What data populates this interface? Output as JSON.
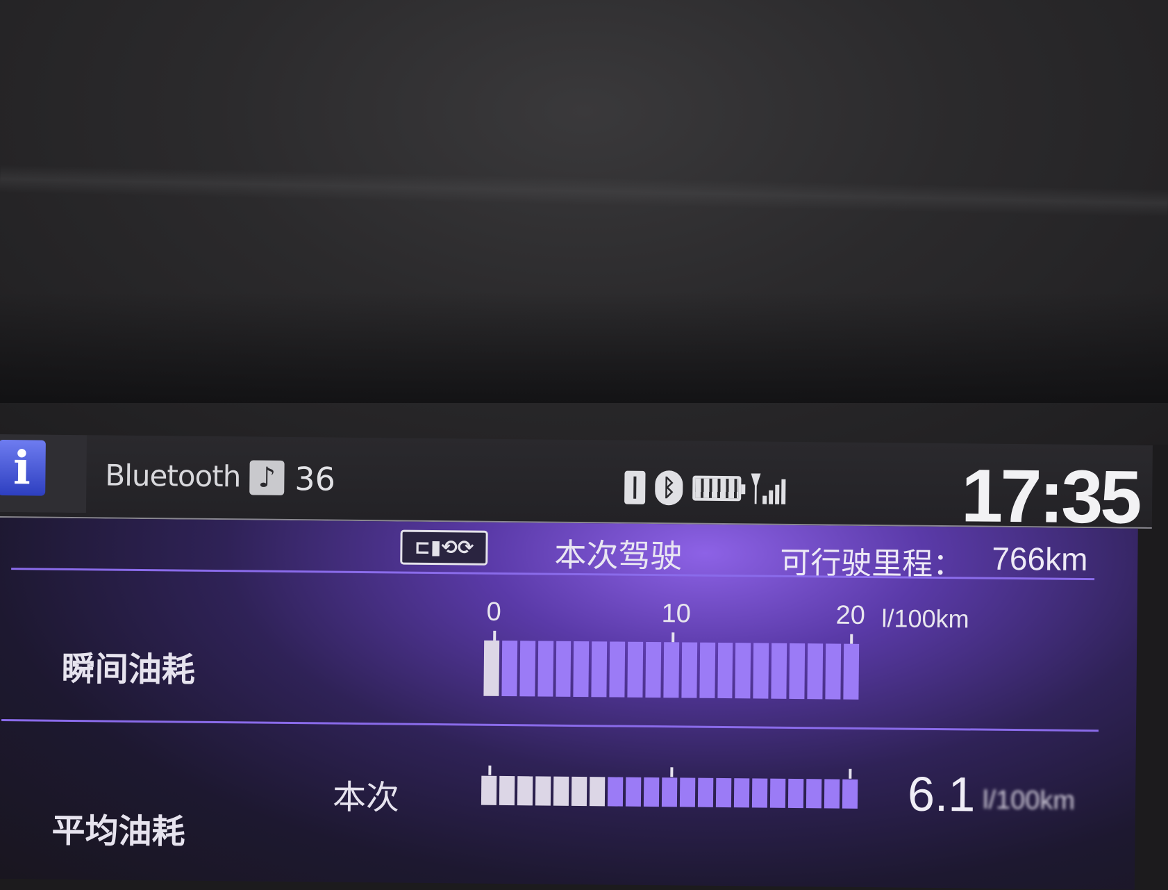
{
  "status_bar": {
    "info_icon": "i",
    "source": "Bluetooth",
    "source_icon": "music-note-icon",
    "volume": "36",
    "icons": [
      "usb-icon",
      "bluetooth-icon",
      "battery-icon",
      "signal-icon"
    ],
    "clock": "17:35"
  },
  "trip": {
    "eco_icon": "eco-mode-icon",
    "label": "本次驾驶",
    "range_label": "可行驶里程：",
    "range_value": "766km"
  },
  "instant": {
    "label": "瞬间油耗",
    "scale": [
      "0",
      "10",
      "20"
    ],
    "unit": "l/100km",
    "segments_total": 21,
    "segments_lit": 1
  },
  "average": {
    "label": "平均油耗",
    "sub_label": "本次",
    "value": "6.1",
    "unit": "l/100km",
    "segments_total": 21,
    "segments_lit": 7
  },
  "colors": {
    "panel": "#5a3aa8",
    "segment": "#9b7bf6",
    "segment_lit": "#dcd6e6",
    "divider": "#8a6bea"
  }
}
